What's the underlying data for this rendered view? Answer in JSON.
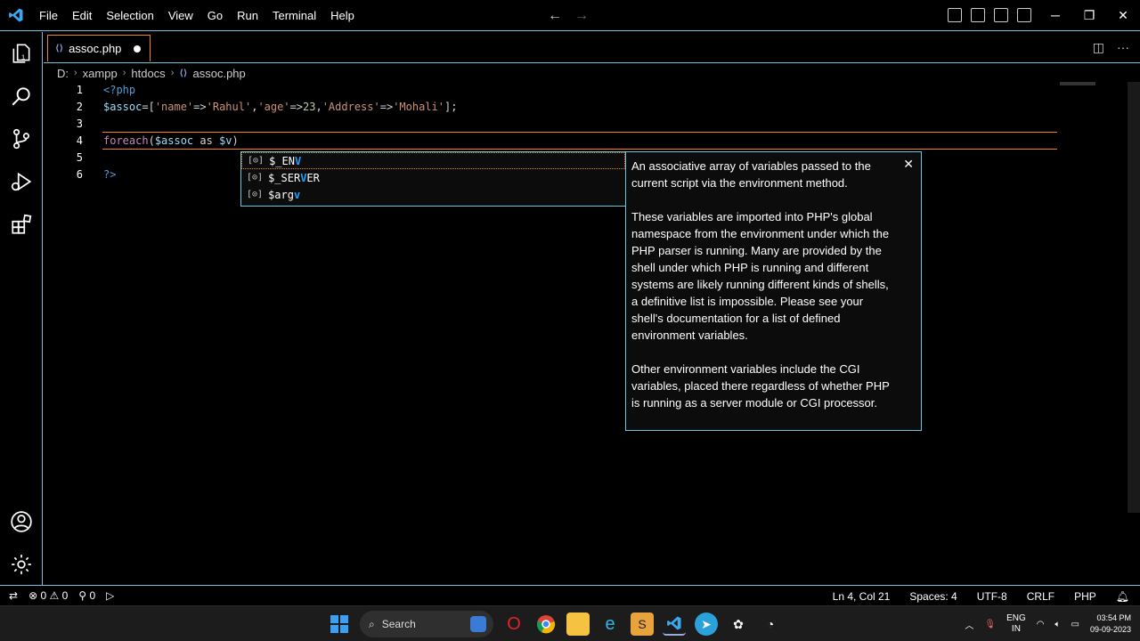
{
  "menu": [
    "File",
    "Edit",
    "Selection",
    "View",
    "Go",
    "Run",
    "Terminal",
    "Help"
  ],
  "tab": {
    "label": "assoc.php",
    "icon": "php-file-icon"
  },
  "breadcrumb": [
    "D:",
    "xampp",
    "htdocs",
    "assoc.php"
  ],
  "editor": {
    "lines": [
      {
        "n": "1",
        "tokens": [
          [
            "c-tag",
            "<?php"
          ]
        ]
      },
      {
        "n": "2",
        "tokens": [
          [
            "c-var",
            "$assoc"
          ],
          [
            "c-op",
            "=["
          ],
          [
            "c-str",
            "'name'"
          ],
          [
            "c-op",
            "=>"
          ],
          [
            "c-str",
            "'Rahul'"
          ],
          [
            "c-op",
            ","
          ],
          [
            "c-str",
            "'age'"
          ],
          [
            "c-op",
            "=>"
          ],
          [
            "c-num",
            "23"
          ],
          [
            "c-op",
            ","
          ],
          [
            "c-str",
            "'Address'"
          ],
          [
            "c-op",
            "=>"
          ],
          [
            "c-str",
            "'Mohali'"
          ],
          [
            "c-op",
            "];"
          ]
        ]
      },
      {
        "n": "3",
        "tokens": []
      },
      {
        "n": "4",
        "tokens": [
          [
            "c-kw",
            "foreach"
          ],
          [
            "c-op",
            "("
          ],
          [
            "c-var",
            "$assoc"
          ],
          [
            "c-op",
            " as "
          ],
          [
            "c-var",
            "$v"
          ],
          [
            "c-op",
            ")"
          ]
        ]
      },
      {
        "n": "5",
        "tokens": []
      },
      {
        "n": "6",
        "tokens": [
          [
            "c-tag",
            "?>"
          ]
        ]
      }
    ]
  },
  "suggest": {
    "items": [
      {
        "prefix": "$_EN",
        "match": "V",
        "rest": ""
      },
      {
        "prefix": "$_SER",
        "match": "V",
        "rest": "ER"
      },
      {
        "prefix": "$arg",
        "match": "v",
        "rest": ""
      }
    ],
    "docs": [
      "An associative array of variables passed to the current script via the environment method.",
      "These variables are imported into PHP's global namespace from the environment under which the PHP parser is running. Many are provided by the shell under which PHP is running and different systems are likely running different kinds of shells, a definitive list is impossible. Please see your shell's documentation for a list of defined environment variables.",
      "Other environment variables include the CGI variables, placed there regardless of whether PHP is running as a server module or CGI processor."
    ]
  },
  "status": {
    "errors": "0",
    "warnings": "0",
    "ports": "0",
    "position": "Ln 4, Col 21",
    "spaces": "Spaces: 4",
    "encoding": "UTF-8",
    "eol": "CRLF",
    "language": "PHP"
  },
  "taskbar": {
    "search_placeholder": "Search",
    "lang_line1": "ENG",
    "lang_line2": "IN",
    "time": "03:54 PM",
    "date": "09-09-2023"
  },
  "colors": {
    "accent": "#6fc3df",
    "focus": "#f38518",
    "match": "#18a3ff"
  }
}
